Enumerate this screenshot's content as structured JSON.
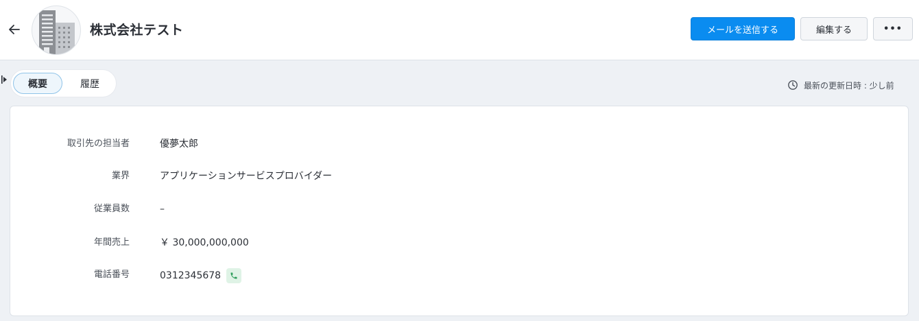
{
  "header": {
    "company_name": "株式会社テスト",
    "send_mail_label": "メールを送信する",
    "edit_label": "編集する",
    "more_label": "•••"
  },
  "tabs": [
    {
      "label": "概要",
      "active": true
    },
    {
      "label": "履歴",
      "active": false
    }
  ],
  "last_updated": "最新の更新日時 : 少し前",
  "details": [
    {
      "label": "取引先の担当者",
      "value": "優夢太郎"
    },
    {
      "label": "業界",
      "value": "アプリケーションサービスプロバイダー"
    },
    {
      "label": "従業員数",
      "value": "–"
    },
    {
      "label": "年間売上",
      "value": "￥ 30,000,000,000"
    },
    {
      "label": "電話番号",
      "value": "0312345678"
    }
  ],
  "colors": {
    "primary": "#0a8cf0",
    "phone_badge_bg": "#dff3e6",
    "phone_icon": "#2e9e5b"
  },
  "icons": {
    "back": "arrow-left-icon",
    "avatar": "building-icon",
    "clock": "clock-icon",
    "phone": "phone-icon",
    "sidebar": "sidebar-toggle-icon"
  }
}
